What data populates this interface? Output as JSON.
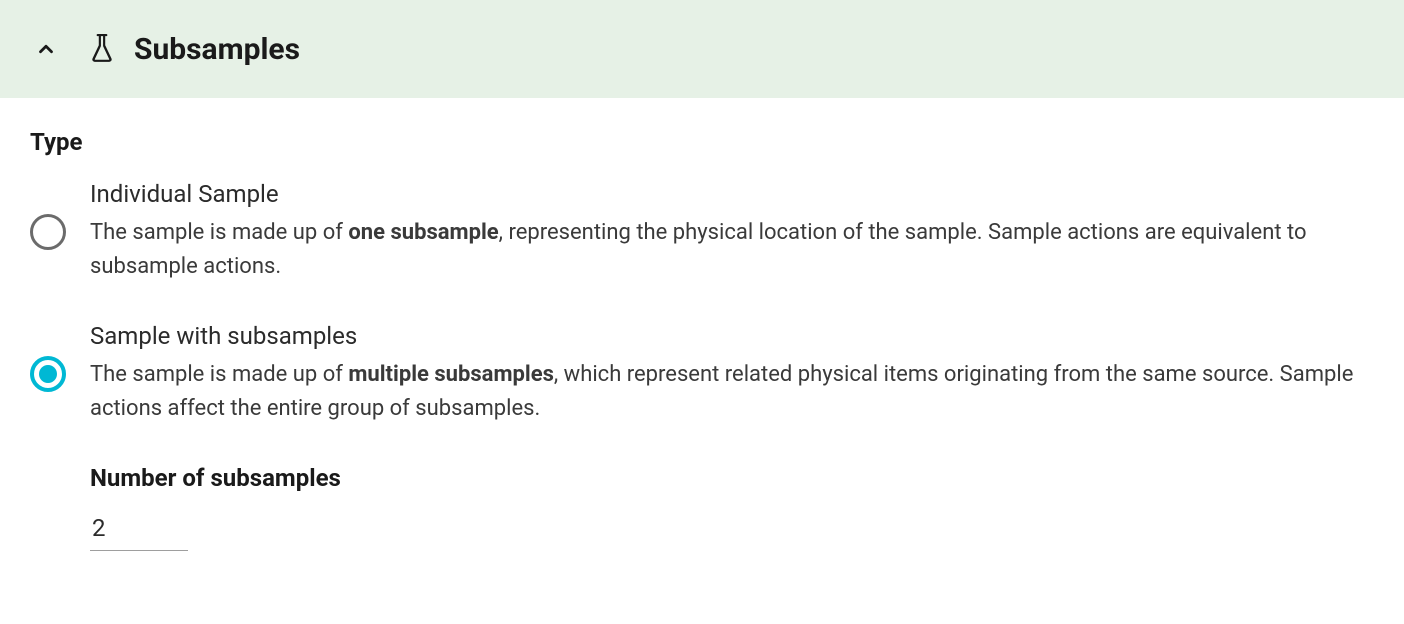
{
  "header": {
    "title": "Subsamples"
  },
  "form": {
    "type_label": "Type",
    "options": [
      {
        "title": "Individual Sample",
        "desc_pre": "The sample is made up of ",
        "desc_bold": "one subsample",
        "desc_post": ", representing the physical location of the sample. Sample actions are equivalent to subsample actions.",
        "selected": false
      },
      {
        "title": "Sample with subsamples",
        "desc_pre": "The sample is made up of ",
        "desc_bold": "multiple subsamples",
        "desc_post": ", which represent related physical items originating from the same source. Sample actions affect the entire group of subsamples.",
        "selected": true
      }
    ],
    "num_label": "Number of subsamples",
    "num_value": "2"
  }
}
